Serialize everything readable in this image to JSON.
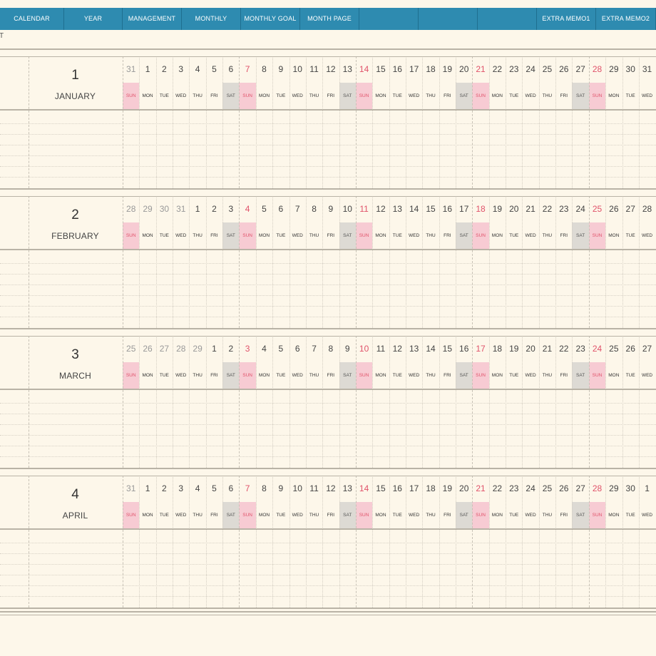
{
  "nav": {
    "tabs": [
      {
        "label": "CALENDAR"
      },
      {
        "label": "YEAR"
      },
      {
        "label": "MANAGEMENT"
      },
      {
        "label": "MONTHLY"
      },
      {
        "label": "MONTHLY GOAL"
      },
      {
        "label": "MONTH PAGE"
      },
      {
        "label": ""
      },
      {
        "label": ""
      },
      {
        "label": ""
      },
      {
        "label": "EXTRA MEMO1"
      },
      {
        "label": "EXTRA MEMO2"
      }
    ]
  },
  "corner_text": "T",
  "weekday_labels": [
    "SUN",
    "MON",
    "TUE",
    "WED",
    "THU",
    "FRI",
    "SAT"
  ],
  "months": [
    {
      "number": "1",
      "name": "JANUARY",
      "start_weekday": 0,
      "days": [
        "31",
        "1",
        "2",
        "3",
        "4",
        "5",
        "6",
        "7",
        "8",
        "9",
        "10",
        "11",
        "12",
        "13",
        "14",
        "15",
        "16",
        "17",
        "18",
        "19",
        "20",
        "21",
        "22",
        "23",
        "24",
        "25",
        "26",
        "27",
        "28",
        "29",
        "30",
        "31"
      ],
      "prev_count": 1
    },
    {
      "number": "2",
      "name": "FEBRUARY",
      "start_weekday": 0,
      "days": [
        "28",
        "29",
        "30",
        "31",
        "1",
        "2",
        "3",
        "4",
        "5",
        "6",
        "7",
        "8",
        "9",
        "10",
        "11",
        "12",
        "13",
        "14",
        "15",
        "16",
        "17",
        "18",
        "19",
        "20",
        "21",
        "22",
        "23",
        "24",
        "25",
        "26",
        "27",
        "28"
      ],
      "prev_count": 4
    },
    {
      "number": "3",
      "name": "MARCH",
      "start_weekday": 0,
      "days": [
        "25",
        "26",
        "27",
        "28",
        "29",
        "1",
        "2",
        "3",
        "4",
        "5",
        "6",
        "7",
        "8",
        "9",
        "10",
        "11",
        "12",
        "13",
        "14",
        "15",
        "16",
        "17",
        "18",
        "19",
        "20",
        "21",
        "22",
        "23",
        "24",
        "25",
        "26",
        "27"
      ],
      "prev_count": 5
    },
    {
      "number": "4",
      "name": "APRIL",
      "start_weekday": 0,
      "days": [
        "31",
        "1",
        "2",
        "3",
        "4",
        "5",
        "6",
        "7",
        "8",
        "9",
        "10",
        "11",
        "12",
        "13",
        "14",
        "15",
        "16",
        "17",
        "18",
        "19",
        "20",
        "21",
        "22",
        "23",
        "24",
        "25",
        "26",
        "27",
        "28",
        "29",
        "30",
        "1"
      ],
      "prev_count": 1
    }
  ]
}
